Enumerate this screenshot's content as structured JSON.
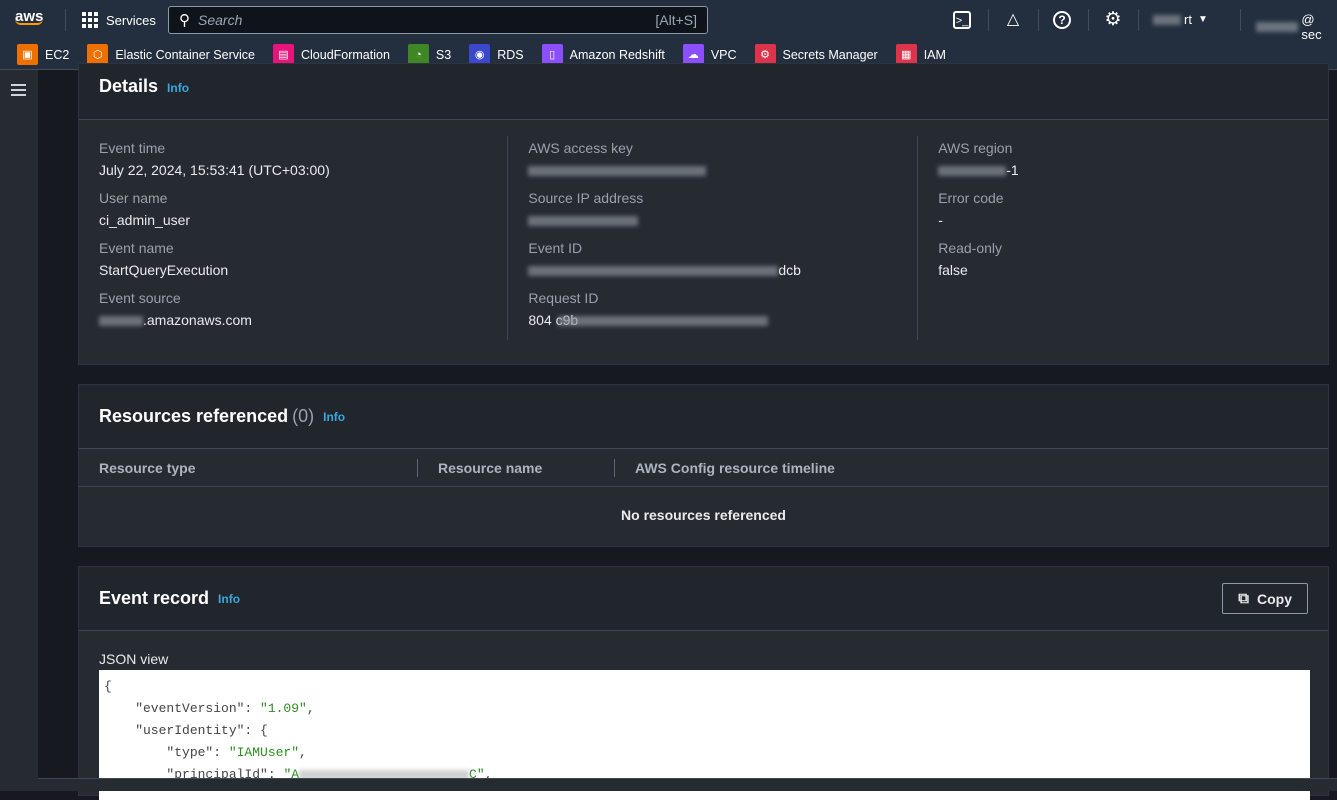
{
  "topbar": {
    "logo": "aws",
    "services": "Services",
    "search_placeholder": "Search",
    "search_shortcut": "[Alt+S]",
    "account_suffix": "rt",
    "user_suffix": "@ sec"
  },
  "favorites": [
    {
      "label": "EC2",
      "color": "#ed7100",
      "icon": "ec2-icon"
    },
    {
      "label": "Elastic Container Service",
      "color": "#ed7100",
      "icon": "ecs-icon"
    },
    {
      "label": "CloudFormation",
      "color": "#e7157b",
      "icon": "cloudformation-icon"
    },
    {
      "label": "S3",
      "color": "#3f8624",
      "icon": "s3-icon"
    },
    {
      "label": "RDS",
      "color": "#3b48cc",
      "icon": "rds-icon"
    },
    {
      "label": "Amazon Redshift",
      "color": "#8c4fff",
      "icon": "redshift-icon"
    },
    {
      "label": "VPC",
      "color": "#8c4fff",
      "icon": "vpc-icon"
    },
    {
      "label": "Secrets Manager",
      "color": "#dd344c",
      "icon": "secrets-manager-icon"
    },
    {
      "label": "IAM",
      "color": "#dd344c",
      "icon": "iam-icon"
    }
  ],
  "details": {
    "title": "Details",
    "info": "Info",
    "col1": [
      {
        "label": "Event time",
        "value": "July 22, 2024, 15:53:41 (UTC+03:00)"
      },
      {
        "label": "User name",
        "value": "ci_admin_user"
      },
      {
        "label": "Event name",
        "value": "StartQueryExecution"
      },
      {
        "label": "Event source",
        "value": ".amazonaws.com"
      }
    ],
    "col2": [
      {
        "label": "AWS access key",
        "value": ""
      },
      {
        "label": "Source IP address",
        "value": ""
      },
      {
        "label": "Event ID",
        "value": "dcb"
      },
      {
        "label": "Request ID",
        "value": "804 c9b"
      }
    ],
    "col3": [
      {
        "label": "AWS region",
        "value": "-1"
      },
      {
        "label": "Error code",
        "value": "-"
      },
      {
        "label": "Read-only",
        "value": "false"
      }
    ]
  },
  "resources": {
    "title": "Resources referenced",
    "count": "(0)",
    "info": "Info",
    "columns": [
      "Resource type",
      "Resource name",
      "AWS Config resource timeline"
    ],
    "empty": "No resources referenced"
  },
  "event_record": {
    "title": "Event record",
    "info": "Info",
    "copy": "Copy",
    "json_label": "JSON view",
    "lines": [
      "{",
      "    \"eventVersion\": ",
      "\"1.09\"",
      ",",
      "    \"userIdentity\": {",
      "        \"type\": ",
      "\"IAMUser\"",
      ",",
      "        \"principalId\": ",
      "\"A",
      "C\"",
      ","
    ]
  }
}
